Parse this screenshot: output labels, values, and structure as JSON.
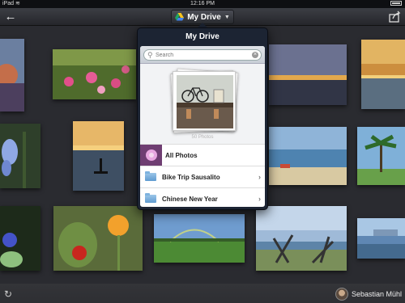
{
  "status_bar": {
    "carrier": "iPad",
    "time": "12:16 PM"
  },
  "toolbar": {
    "title": "My Drive",
    "back_icon": "back-arrow-icon",
    "share_icon": "share-icon"
  },
  "popover": {
    "title": "My Drive",
    "search": {
      "placeholder": "Search",
      "value": ""
    },
    "album": {
      "count_label": "50 Photos"
    },
    "items": [
      {
        "label": "All Photos",
        "type": "album"
      },
      {
        "label": "Bike Trip Sausalito",
        "type": "folder"
      },
      {
        "label": "Chinese New Year",
        "type": "folder"
      }
    ]
  },
  "bottom_bar": {
    "refresh_icon": "refresh-icon",
    "user_name": "Sebastian Mühl"
  }
}
